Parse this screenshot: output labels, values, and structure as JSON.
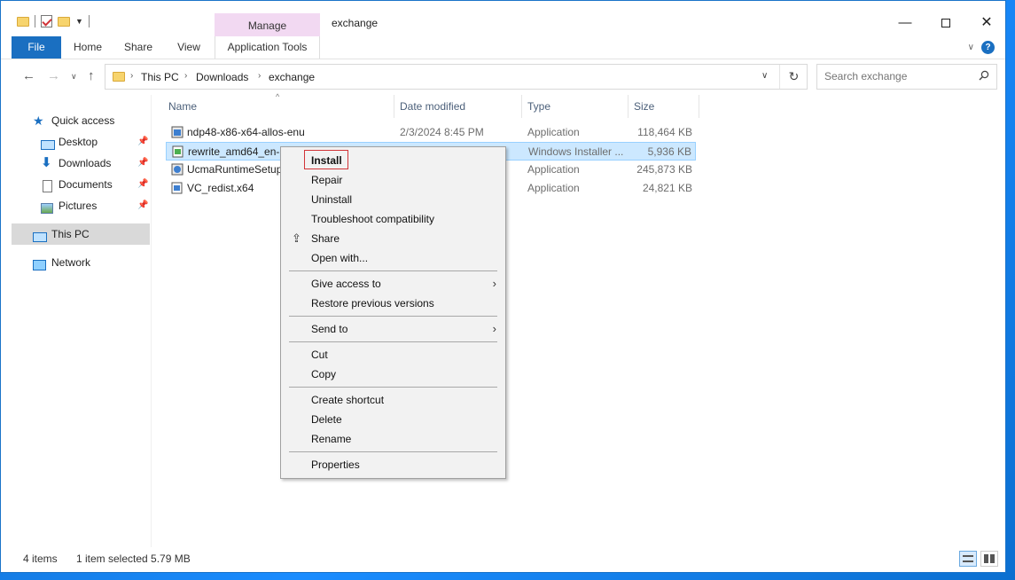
{
  "window": {
    "title": "exchange",
    "contextual_tab_group": "Manage"
  },
  "ribbon": {
    "tabs": [
      "File",
      "Home",
      "Share",
      "View",
      "Application Tools"
    ]
  },
  "address": {
    "crumbs": [
      "This PC",
      "Downloads",
      "exchange"
    ]
  },
  "search": {
    "placeholder": "Search exchange"
  },
  "nav_pane": {
    "items": [
      {
        "label": "Quick access",
        "icon": "star-icon"
      },
      {
        "label": "Desktop",
        "icon": "desktop-icon",
        "pinned": true
      },
      {
        "label": "Downloads",
        "icon": "downloads-icon",
        "pinned": true
      },
      {
        "label": "Documents",
        "icon": "documents-icon",
        "pinned": true
      },
      {
        "label": "Pictures",
        "icon": "pictures-icon",
        "pinned": true
      },
      {
        "label": "This PC",
        "icon": "this-pc-icon",
        "selected": true
      },
      {
        "label": "Network",
        "icon": "network-icon"
      }
    ]
  },
  "file_list": {
    "columns": [
      "Name",
      "Date modified",
      "Type",
      "Size"
    ],
    "rows": [
      {
        "name": "ndp48-x86-x64-allos-enu",
        "date": "2/3/2024 8:45 PM",
        "type": "Application",
        "size": "118,464 KB"
      },
      {
        "name": "rewrite_amd64_en-U",
        "date": "",
        "type": "Windows Installer ...",
        "size": "5,936 KB",
        "selected": true
      },
      {
        "name": "UcmaRuntimeSetup",
        "date": "",
        "type": "Application",
        "size": "245,873 KB"
      },
      {
        "name": "VC_redist.x64",
        "date": "",
        "type": "Application",
        "size": "24,821 KB"
      }
    ]
  },
  "context_menu": {
    "items": [
      {
        "label": "Install",
        "bold": true,
        "highlighted": true
      },
      {
        "label": "Repair"
      },
      {
        "label": "Uninstall"
      },
      {
        "label": "Troubleshoot compatibility"
      },
      {
        "label": "Share",
        "icon": "share-icon"
      },
      {
        "label": "Open with..."
      },
      {
        "label": "Give access to",
        "submenu": true
      },
      {
        "label": "Restore previous versions"
      },
      {
        "label": "Send to",
        "submenu": true
      },
      {
        "label": "Cut"
      },
      {
        "label": "Copy"
      },
      {
        "label": "Create shortcut"
      },
      {
        "label": "Delete"
      },
      {
        "label": "Rename"
      },
      {
        "label": "Properties"
      }
    ]
  },
  "status_bar": {
    "item_count": "4 items",
    "selection": "1 item selected  5.79 MB"
  },
  "colors": {
    "accent": "#1a6fc1",
    "selection_bg": "#cce8ff",
    "manage_tab": "#f2d9f2",
    "highlight_border": "#d13438"
  }
}
